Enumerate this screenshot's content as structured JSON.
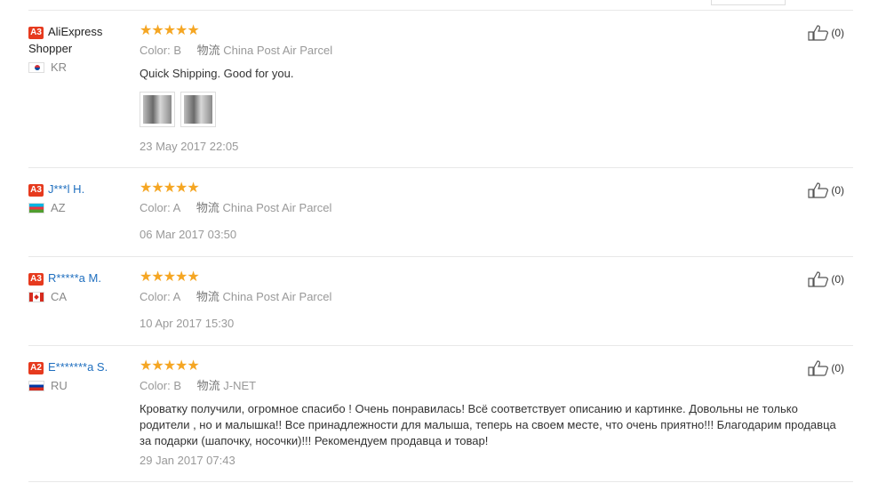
{
  "reviews": [
    {
      "badge": "A3",
      "name": "AliExpress Shopper",
      "country": "KR",
      "rating": "★★★★★",
      "color_label": "Color:",
      "color_value": "B",
      "shipping_cn": "物流",
      "shipping": "China Post Air Parcel",
      "text": "Quick Shipping. Good for you.",
      "has_photos": true,
      "date": "23 May 2017 22:05",
      "helpful": "(0)"
    },
    {
      "badge": "A3",
      "name": "J***l H.",
      "country": "AZ",
      "rating": "★★★★★",
      "color_label": "Color:",
      "color_value": "A",
      "shipping_cn": "物流",
      "shipping": "China Post Air Parcel",
      "text": "",
      "date": "06 Mar 2017 03:50",
      "helpful": "(0)"
    },
    {
      "badge": "A3",
      "name": "R*****a M.",
      "country": "CA",
      "rating": "★★★★★",
      "color_label": "Color:",
      "color_value": "A",
      "shipping_cn": "物流",
      "shipping": "China Post Air Parcel",
      "text": "",
      "date": "10 Apr 2017 15:30",
      "helpful": "(0)"
    },
    {
      "badge": "A2",
      "name": "E*******a S.",
      "country": "RU",
      "rating": "★★★★★",
      "color_label": "Color:",
      "color_value": "B",
      "shipping_cn": "物流",
      "shipping": "J-NET",
      "text": "Кроватку получили, огромное спасибо ! Очень понравилась! Всё соответствует описанию и картинке. Довольны не только родители , но и малышка!! Все принадлежности для малыша, теперь на своем месте, что очень приятно!!! Благодарим продавца за подарки (шапочку, носочки)!!! Рекомендуем продавца и товар!",
      "date": "29 Jan 2017 07:43",
      "helpful": "(0)"
    }
  ],
  "colors": {
    "star": "#f5a623",
    "badge": "#e63a1e",
    "link": "#1f6fbf"
  },
  "icons": {
    "helpful": "thumbs-up-icon"
  }
}
